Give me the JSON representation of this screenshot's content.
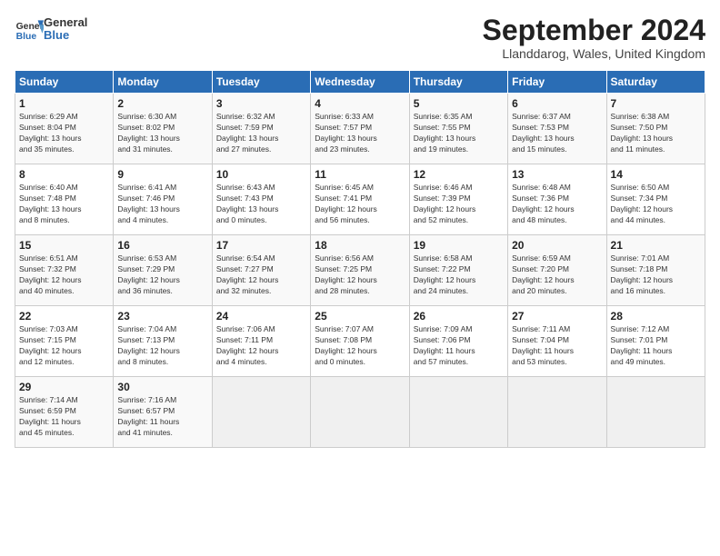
{
  "header": {
    "logo_line1": "General",
    "logo_line2": "Blue",
    "month": "September 2024",
    "location": "Llanddarog, Wales, United Kingdom"
  },
  "days_of_week": [
    "Sunday",
    "Monday",
    "Tuesday",
    "Wednesday",
    "Thursday",
    "Friday",
    "Saturday"
  ],
  "weeks": [
    [
      {
        "day": "1",
        "info": "Sunrise: 6:29 AM\nSunset: 8:04 PM\nDaylight: 13 hours\nand 35 minutes."
      },
      {
        "day": "2",
        "info": "Sunrise: 6:30 AM\nSunset: 8:02 PM\nDaylight: 13 hours\nand 31 minutes."
      },
      {
        "day": "3",
        "info": "Sunrise: 6:32 AM\nSunset: 7:59 PM\nDaylight: 13 hours\nand 27 minutes."
      },
      {
        "day": "4",
        "info": "Sunrise: 6:33 AM\nSunset: 7:57 PM\nDaylight: 13 hours\nand 23 minutes."
      },
      {
        "day": "5",
        "info": "Sunrise: 6:35 AM\nSunset: 7:55 PM\nDaylight: 13 hours\nand 19 minutes."
      },
      {
        "day": "6",
        "info": "Sunrise: 6:37 AM\nSunset: 7:53 PM\nDaylight: 13 hours\nand 15 minutes."
      },
      {
        "day": "7",
        "info": "Sunrise: 6:38 AM\nSunset: 7:50 PM\nDaylight: 13 hours\nand 11 minutes."
      }
    ],
    [
      {
        "day": "8",
        "info": "Sunrise: 6:40 AM\nSunset: 7:48 PM\nDaylight: 13 hours\nand 8 minutes."
      },
      {
        "day": "9",
        "info": "Sunrise: 6:41 AM\nSunset: 7:46 PM\nDaylight: 13 hours\nand 4 minutes."
      },
      {
        "day": "10",
        "info": "Sunrise: 6:43 AM\nSunset: 7:43 PM\nDaylight: 13 hours\nand 0 minutes."
      },
      {
        "day": "11",
        "info": "Sunrise: 6:45 AM\nSunset: 7:41 PM\nDaylight: 12 hours\nand 56 minutes."
      },
      {
        "day": "12",
        "info": "Sunrise: 6:46 AM\nSunset: 7:39 PM\nDaylight: 12 hours\nand 52 minutes."
      },
      {
        "day": "13",
        "info": "Sunrise: 6:48 AM\nSunset: 7:36 PM\nDaylight: 12 hours\nand 48 minutes."
      },
      {
        "day": "14",
        "info": "Sunrise: 6:50 AM\nSunset: 7:34 PM\nDaylight: 12 hours\nand 44 minutes."
      }
    ],
    [
      {
        "day": "15",
        "info": "Sunrise: 6:51 AM\nSunset: 7:32 PM\nDaylight: 12 hours\nand 40 minutes."
      },
      {
        "day": "16",
        "info": "Sunrise: 6:53 AM\nSunset: 7:29 PM\nDaylight: 12 hours\nand 36 minutes."
      },
      {
        "day": "17",
        "info": "Sunrise: 6:54 AM\nSunset: 7:27 PM\nDaylight: 12 hours\nand 32 minutes."
      },
      {
        "day": "18",
        "info": "Sunrise: 6:56 AM\nSunset: 7:25 PM\nDaylight: 12 hours\nand 28 minutes."
      },
      {
        "day": "19",
        "info": "Sunrise: 6:58 AM\nSunset: 7:22 PM\nDaylight: 12 hours\nand 24 minutes."
      },
      {
        "day": "20",
        "info": "Sunrise: 6:59 AM\nSunset: 7:20 PM\nDaylight: 12 hours\nand 20 minutes."
      },
      {
        "day": "21",
        "info": "Sunrise: 7:01 AM\nSunset: 7:18 PM\nDaylight: 12 hours\nand 16 minutes."
      }
    ],
    [
      {
        "day": "22",
        "info": "Sunrise: 7:03 AM\nSunset: 7:15 PM\nDaylight: 12 hours\nand 12 minutes."
      },
      {
        "day": "23",
        "info": "Sunrise: 7:04 AM\nSunset: 7:13 PM\nDaylight: 12 hours\nand 8 minutes."
      },
      {
        "day": "24",
        "info": "Sunrise: 7:06 AM\nSunset: 7:11 PM\nDaylight: 12 hours\nand 4 minutes."
      },
      {
        "day": "25",
        "info": "Sunrise: 7:07 AM\nSunset: 7:08 PM\nDaylight: 12 hours\nand 0 minutes."
      },
      {
        "day": "26",
        "info": "Sunrise: 7:09 AM\nSunset: 7:06 PM\nDaylight: 11 hours\nand 57 minutes."
      },
      {
        "day": "27",
        "info": "Sunrise: 7:11 AM\nSunset: 7:04 PM\nDaylight: 11 hours\nand 53 minutes."
      },
      {
        "day": "28",
        "info": "Sunrise: 7:12 AM\nSunset: 7:01 PM\nDaylight: 11 hours\nand 49 minutes."
      }
    ],
    [
      {
        "day": "29",
        "info": "Sunrise: 7:14 AM\nSunset: 6:59 PM\nDaylight: 11 hours\nand 45 minutes."
      },
      {
        "day": "30",
        "info": "Sunrise: 7:16 AM\nSunset: 6:57 PM\nDaylight: 11 hours\nand 41 minutes."
      },
      {
        "day": "",
        "info": ""
      },
      {
        "day": "",
        "info": ""
      },
      {
        "day": "",
        "info": ""
      },
      {
        "day": "",
        "info": ""
      },
      {
        "day": "",
        "info": ""
      }
    ]
  ]
}
